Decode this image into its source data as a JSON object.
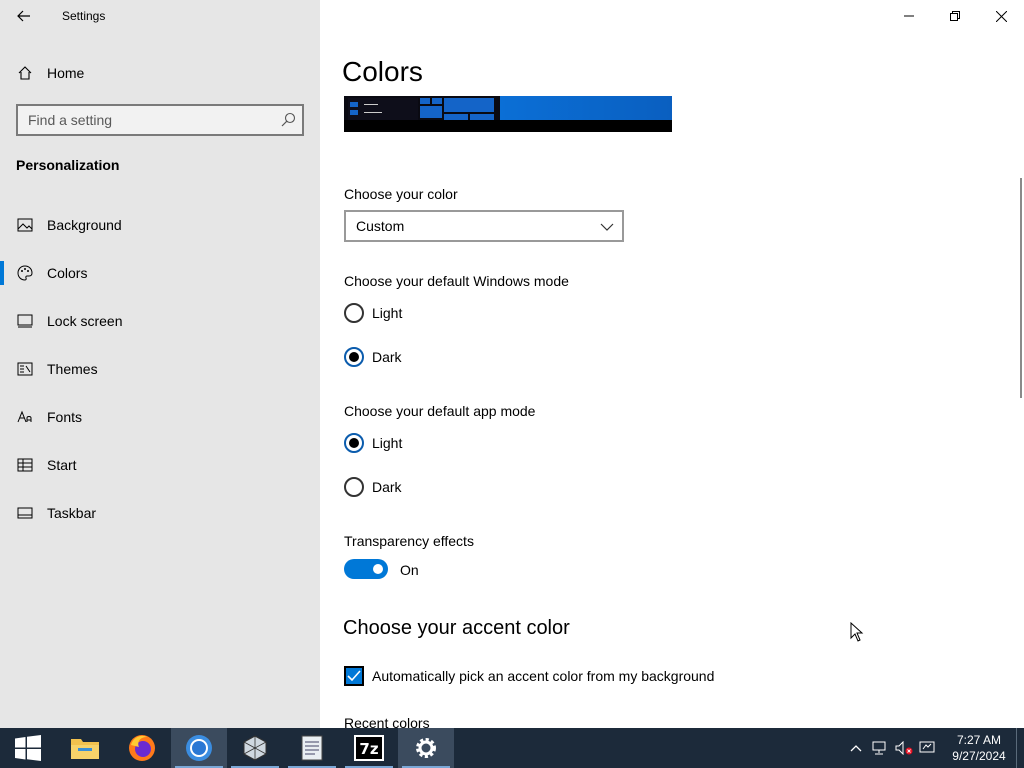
{
  "window": {
    "app_title": "Settings"
  },
  "sidebar": {
    "home_label": "Home",
    "search_placeholder": "Find a setting",
    "section_title": "Personalization",
    "items": [
      {
        "label": "Background",
        "icon": "picture-icon"
      },
      {
        "label": "Colors",
        "icon": "palette-icon",
        "active": true
      },
      {
        "label": "Lock screen",
        "icon": "lock-screen-icon"
      },
      {
        "label": "Themes",
        "icon": "themes-icon"
      },
      {
        "label": "Fonts",
        "icon": "fonts-icon"
      },
      {
        "label": "Start",
        "icon": "start-icon"
      },
      {
        "label": "Taskbar",
        "icon": "taskbar-icon"
      }
    ]
  },
  "main": {
    "title": "Colors",
    "choose_color_label": "Choose your color",
    "choose_color_value": "Custom",
    "windows_mode_label": "Choose your default Windows mode",
    "windows_mode_options": [
      "Light",
      "Dark"
    ],
    "windows_mode_selected": "Dark",
    "app_mode_label": "Choose your default app mode",
    "app_mode_options": [
      "Light",
      "Dark"
    ],
    "app_mode_selected": "Light",
    "transparency_label": "Transparency effects",
    "transparency_state": "On",
    "accent_heading": "Choose your accent color",
    "auto_accent_label": "Automatically pick an accent color from my background",
    "auto_accent_checked": true,
    "recent_colors_label": "Recent colors"
  },
  "taskbar": {
    "apps": [
      "start",
      "file-explorer",
      "firefox",
      "chrome",
      "virtualbox",
      "notepad",
      "7zip",
      "settings"
    ],
    "clock_time": "7:27 AM",
    "clock_date": "9/27/2024"
  },
  "colors": {
    "accent": "#0078d7",
    "sidebar_bg": "#e6e6e6",
    "taskbar_bg": "#1c2a3a"
  }
}
